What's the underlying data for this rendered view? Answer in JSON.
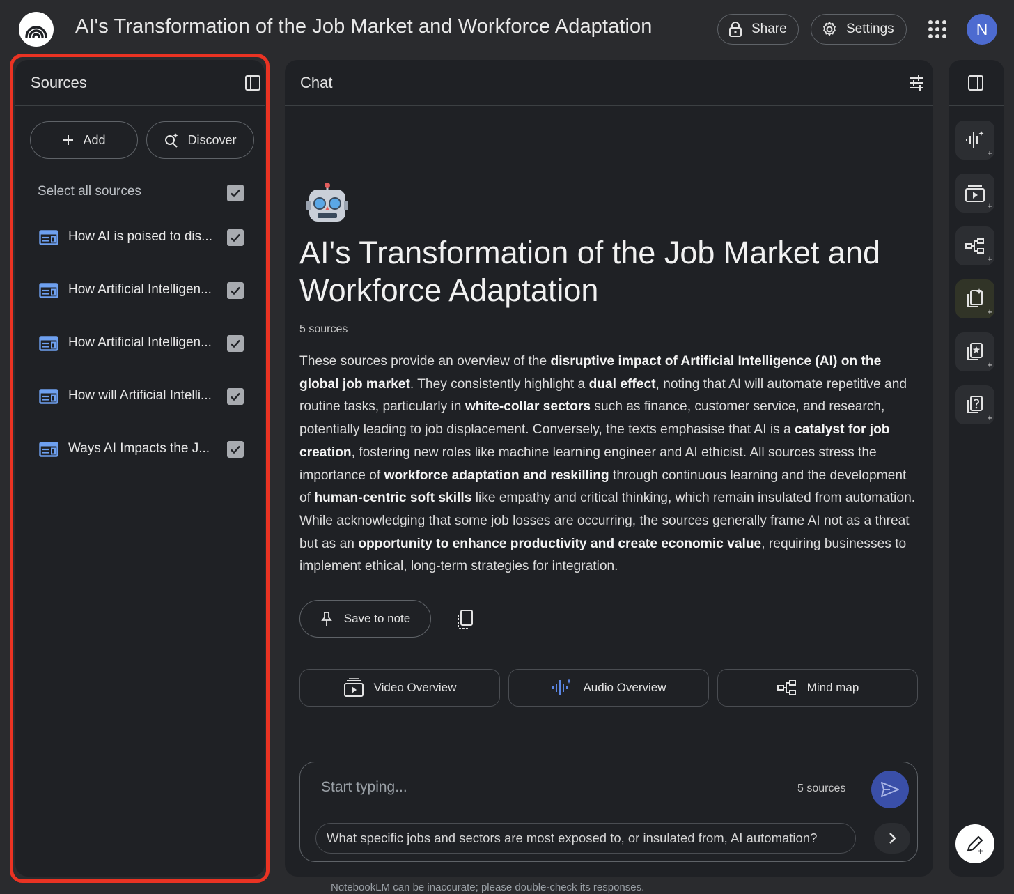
{
  "header": {
    "title": "AI's Transformation of the Job Market and Workforce Adaptation",
    "share_label": "Share",
    "settings_label": "Settings",
    "avatar_initial": "N"
  },
  "sources": {
    "title": "Sources",
    "add_label": "Add",
    "discover_label": "Discover",
    "select_all_label": "Select all sources",
    "items": [
      {
        "label": "How AI is poised to dis..."
      },
      {
        "label": "How Artificial Intelligen..."
      },
      {
        "label": "How Artificial Intelligen..."
      },
      {
        "label": "How will Artificial Intelli..."
      },
      {
        "label": "Ways AI Impacts the J..."
      }
    ]
  },
  "chat": {
    "title": "Chat",
    "notebook_title": "AI's Transformation of the Job Market and Workforce Adaptation",
    "source_count": "5 sources",
    "summary_parts": [
      {
        "t": "These sources provide an overview of the ",
        "b": false
      },
      {
        "t": "disruptive impact of Artificial Intelligence (AI) on the global job market",
        "b": true
      },
      {
        "t": ". They consistently highlight a ",
        "b": false
      },
      {
        "t": "dual effect",
        "b": true
      },
      {
        "t": ", noting that AI will automate repetitive and routine tasks, particularly in ",
        "b": false
      },
      {
        "t": "white-collar sectors",
        "b": true
      },
      {
        "t": " such as finance, customer service, and research, potentially leading to job displacement. Conversely, the texts emphasise that AI is a ",
        "b": false
      },
      {
        "t": "catalyst for job creation",
        "b": true
      },
      {
        "t": ", fostering new roles like machine learning engineer and AI ethicist. All sources stress the importance of ",
        "b": false
      },
      {
        "t": "workforce adaptation and reskilling",
        "b": true
      },
      {
        "t": " through continuous learning and the development of ",
        "b": false
      },
      {
        "t": "human-centric soft skills",
        "b": true
      },
      {
        "t": " like empathy and critical thinking, which remain insulated from automation. While acknowledging that some job losses are occurring, the sources generally frame AI not as a threat but as an ",
        "b": false
      },
      {
        "t": "opportunity to enhance productivity and create economic value",
        "b": true
      },
      {
        "t": ", requiring businesses to implement ethical, long-term strategies for integration.",
        "b": false
      }
    ],
    "save_to_note_label": "Save to note",
    "video_overview_label": "Video Overview",
    "audio_overview_label": "Audio Overview",
    "mind_map_label": "Mind map",
    "input_placeholder": "Start typing...",
    "input_source_count": "5 sources",
    "suggestion": "What specific jobs and sectors are most exposed to, or insulated from, AI automation?"
  },
  "footer": {
    "disclaimer": "NotebookLM can be inaccurate; please double-check its responses."
  },
  "colors": {
    "background": "#2a2b2e",
    "panel": "#1f2125",
    "highlight_border": "#ea3323",
    "source_icon": "#6ea0f0",
    "send_button": "#3a4fa8",
    "avatar": "#4d6bd0"
  }
}
